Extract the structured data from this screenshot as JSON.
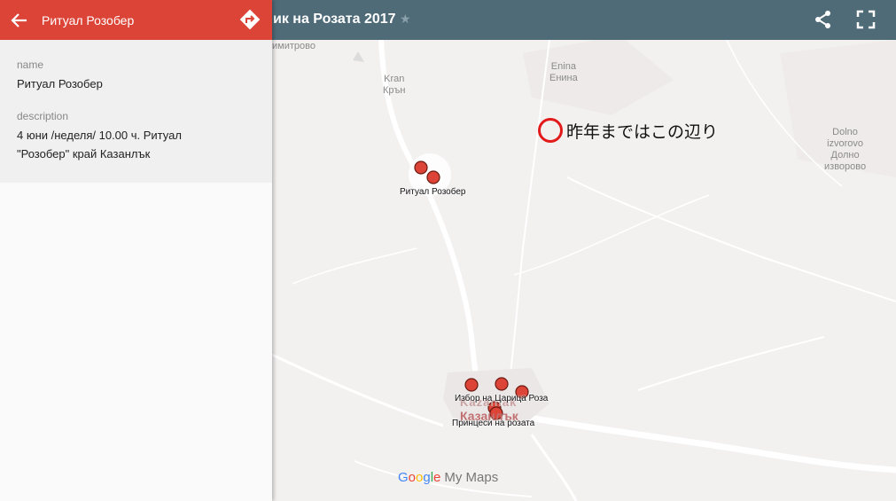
{
  "topbar": {
    "title": "ик на Розата 2017"
  },
  "panel": {
    "title": "Ритуал Розобер",
    "name_label": "name",
    "name_value": "Ритуал Розобер",
    "description_label": "description",
    "description_value": "4 юни /неделя/ 10.00 ч. Ритуал \"Розобер\" край Казанлък"
  },
  "map": {
    "towns": {
      "dimitrovo": "имитрово",
      "kran_latin": "Kran",
      "kran_cyr": "Крън",
      "enina_latin": "Enina",
      "enina_cyr": "Енина",
      "dolno_latin_1": "Dolno",
      "dolno_latin_2": "izvorovo",
      "dolno_cyr_1": "Долно",
      "dolno_cyr_2": "изворово",
      "kazanlak_latin": "Kazanlak",
      "kazanlak_cyr": "Казанлък"
    },
    "markers": {
      "rozober": "Ритуал Розобер",
      "izbor": "Избор на Царица Роза",
      "princesi": "Принцеси на розата"
    },
    "annotation": "昨年まではこの辺り"
  },
  "logo": {
    "google": [
      "G",
      "o",
      "o",
      "g",
      "l",
      "e"
    ],
    "mymaps": "My Maps"
  },
  "colors": {
    "panel_header": "#db4437",
    "topbar": "#4f6b78",
    "marker": "#db4437"
  }
}
